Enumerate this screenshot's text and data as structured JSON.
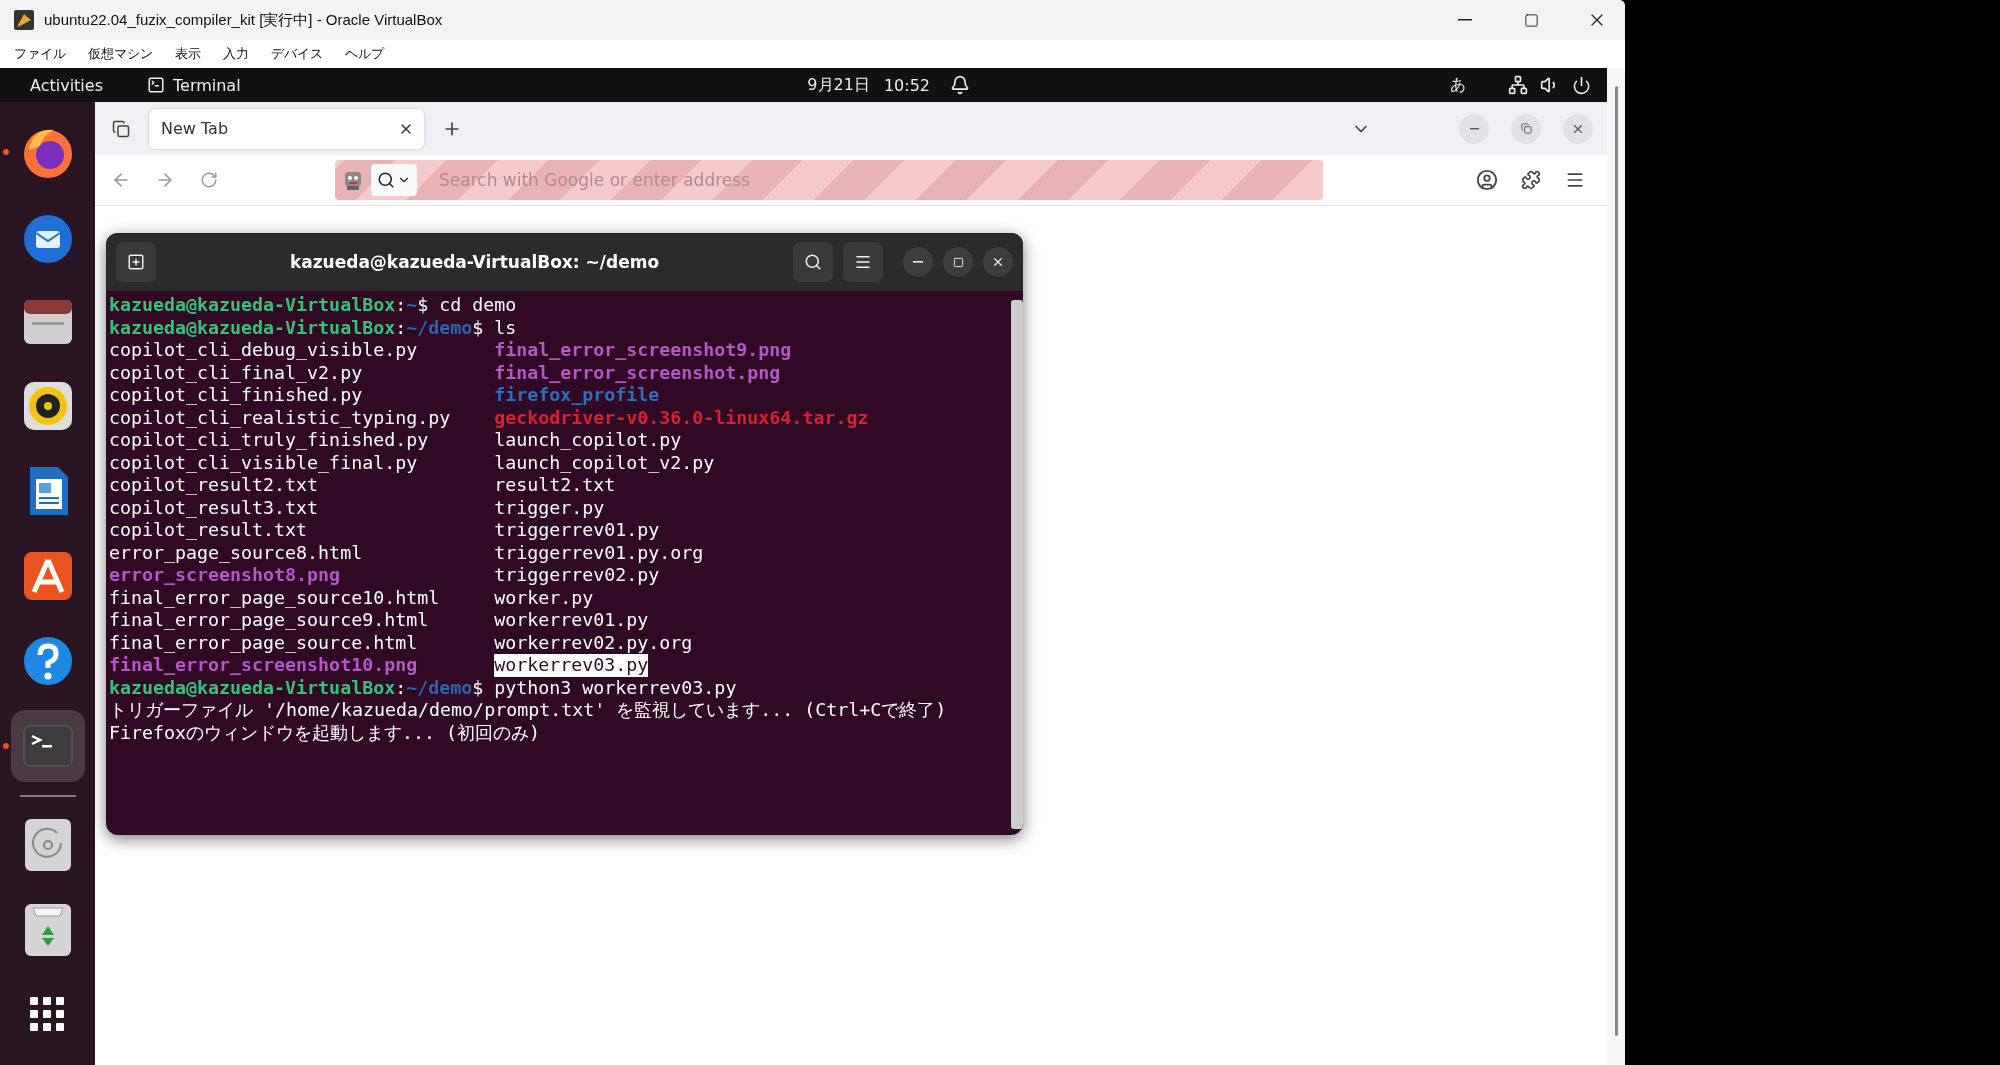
{
  "vbox": {
    "title": "ubuntu22.04_fuzix_compiler_kit [実行中] - Oracle VirtualBox",
    "menu": [
      "ファイル",
      "仮想マシン",
      "表示",
      "入力",
      "デバイス",
      "ヘルプ"
    ]
  },
  "topbar": {
    "activities": "Activities",
    "app": "Terminal",
    "date": "9月21日",
    "time": "10:52",
    "input_method": "あ"
  },
  "dock": [
    {
      "kind": "firefox",
      "running": true,
      "active": false
    },
    {
      "kind": "thunderbird",
      "running": false,
      "active": false
    },
    {
      "kind": "files",
      "running": false,
      "active": false
    },
    {
      "kind": "rhythmbox",
      "running": false,
      "active": false
    },
    {
      "kind": "writer",
      "running": false,
      "active": false
    },
    {
      "kind": "store",
      "running": false,
      "active": false
    },
    {
      "kind": "help",
      "running": false,
      "active": false
    },
    {
      "kind": "terminal",
      "running": true,
      "active": true
    },
    {
      "kind": "separator"
    },
    {
      "kind": "disc",
      "running": false,
      "active": false
    },
    {
      "kind": "trash",
      "running": false,
      "active": false
    },
    {
      "kind": "apps",
      "running": false,
      "active": false
    }
  ],
  "browser": {
    "tabs": [
      {
        "label": "New Tab",
        "selected": true
      }
    ],
    "address_placeholder": "Search with Google or enter address"
  },
  "terminal": {
    "title": "kazueda@kazueda-VirtualBox: ~/demo",
    "lines": [
      {
        "kind": "prompt",
        "user": "kazueda@kazueda-VirtualBox",
        "separator": ":",
        "path": "~",
        "command": "$ cd demo"
      },
      {
        "kind": "prompt",
        "user": "kazueda@kazueda-VirtualBox",
        "separator": ":",
        "path": "~/demo",
        "command": "$ ls"
      },
      {
        "kind": "ls",
        "entries": [
          {
            "name": "copilot_cli_debug_visible.py",
            "kind": "file",
            "selected": false
          },
          {
            "name": "final_error_screenshot9.png",
            "kind": "image",
            "selected": false
          }
        ]
      },
      {
        "kind": "ls",
        "entries": [
          {
            "name": "copilot_cli_final_v2.py",
            "kind": "file",
            "selected": false
          },
          {
            "name": "final_error_screenshot.png",
            "kind": "image",
            "selected": false
          }
        ]
      },
      {
        "kind": "ls",
        "entries": [
          {
            "name": "copilot_cli_finished.py",
            "kind": "file",
            "selected": false
          },
          {
            "name": "firefox_profile",
            "kind": "directory",
            "selected": false
          }
        ]
      },
      {
        "kind": "ls",
        "entries": [
          {
            "name": "copilot_cli_realistic_typing.py",
            "kind": "file",
            "selected": false
          },
          {
            "name": "geckodriver-v0.36.0-linux64.tar.gz",
            "kind": "archive",
            "selected": false
          }
        ]
      },
      {
        "kind": "ls",
        "entries": [
          {
            "name": "copilot_cli_truly_finished.py",
            "kind": "file",
            "selected": false
          },
          {
            "name": "launch_copilot.py",
            "kind": "file",
            "selected": false
          }
        ]
      },
      {
        "kind": "ls",
        "entries": [
          {
            "name": "copilot_cli_visible_final.py",
            "kind": "file",
            "selected": false
          },
          {
            "name": "launch_copilot_v2.py",
            "kind": "file",
            "selected": false
          }
        ]
      },
      {
        "kind": "ls",
        "entries": [
          {
            "name": "copilot_result2.txt",
            "kind": "file",
            "selected": false
          },
          {
            "name": "result2.txt",
            "kind": "file",
            "selected": false
          }
        ]
      },
      {
        "kind": "ls",
        "entries": [
          {
            "name": "copilot_result3.txt",
            "kind": "file",
            "selected": false
          },
          {
            "name": "trigger.py",
            "kind": "file",
            "selected": false
          }
        ]
      },
      {
        "kind": "ls",
        "entries": [
          {
            "name": "copilot_result.txt",
            "kind": "file",
            "selected": false
          },
          {
            "name": "triggerrev01.py",
            "kind": "file",
            "selected": false
          }
        ]
      },
      {
        "kind": "ls",
        "entries": [
          {
            "name": "error_page_source8.html",
            "kind": "file",
            "selected": false
          },
          {
            "name": "triggerrev01.py.org",
            "kind": "file",
            "selected": false
          }
        ]
      },
      {
        "kind": "ls",
        "entries": [
          {
            "name": "error_screenshot8.png",
            "kind": "image",
            "selected": false
          },
          {
            "name": "triggerrev02.py",
            "kind": "file",
            "selected": false
          }
        ]
      },
      {
        "kind": "ls",
        "entries": [
          {
            "name": "final_error_page_source10.html",
            "kind": "file",
            "selected": false
          },
          {
            "name": "worker.py",
            "kind": "file",
            "selected": false
          }
        ]
      },
      {
        "kind": "ls",
        "entries": [
          {
            "name": "final_error_page_source9.html",
            "kind": "file",
            "selected": false
          },
          {
            "name": "workerrev01.py",
            "kind": "file",
            "selected": false
          }
        ]
      },
      {
        "kind": "ls",
        "entries": [
          {
            "name": "final_error_page_source.html",
            "kind": "file",
            "selected": false
          },
          {
            "name": "workerrev02.py.org",
            "kind": "file",
            "selected": false
          }
        ]
      },
      {
        "kind": "ls",
        "entries": [
          {
            "name": "final_error_screenshot10.png",
            "kind": "image",
            "selected": false
          },
          {
            "name": "workerrev03.py",
            "kind": "file",
            "selected": true
          }
        ]
      },
      {
        "kind": "prompt",
        "user": "kazueda@kazueda-VirtualBox",
        "separator": ":",
        "path": "~/demo",
        "command": "$ python3 workerrev03.py"
      },
      {
        "kind": "output",
        "text": "トリガーファイル '/home/kazueda/demo/prompt.txt' を監視しています... (Ctrl+Cで終了)"
      },
      {
        "kind": "output",
        "text": "Firefoxのウィンドウを起動します... (初回のみ)"
      }
    ]
  }
}
